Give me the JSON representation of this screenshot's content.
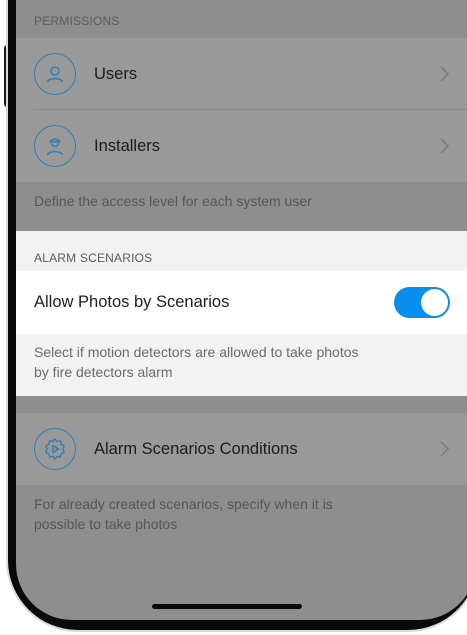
{
  "permissions": {
    "header": "PERMISSIONS",
    "items": [
      {
        "label": "Users",
        "icon": "user-icon"
      },
      {
        "label": "Installers",
        "icon": "installer-icon"
      }
    ],
    "caption": "Define the access level for each system user"
  },
  "alarm_scenarios": {
    "header": "ALARM SCENARIOS",
    "toggle_label": "Allow Photos by Scenarios",
    "toggle_on": true,
    "caption_line1": "Select if motion detectors are allowed to take photos",
    "caption_line2": "by fire detectors alarm"
  },
  "conditions": {
    "label": "Alarm Scenarios Conditions",
    "icon": "scenario-gear-icon",
    "caption_line1": "For already created scenarios, specify when it is",
    "caption_line2": "possible to take photos"
  },
  "colors": {
    "accent": "#0a8df0",
    "icon_stroke": "#2b7fb5",
    "overlay_row": "#999999",
    "overlay_bg": "#8e8e8e"
  }
}
